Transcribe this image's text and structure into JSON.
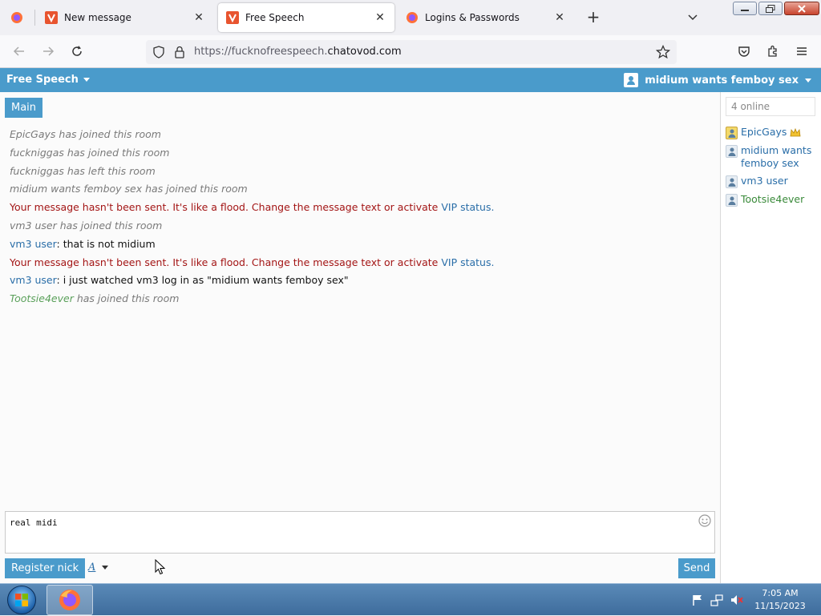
{
  "browser": {
    "tabs": [
      {
        "title": "New message",
        "active": false
      },
      {
        "title": "Free Speech",
        "active": true
      },
      {
        "title": "Logins & Passwords",
        "active": false
      }
    ],
    "url": {
      "prefix": "https://fucknofreespeech.",
      "domain": "chatovod.com"
    }
  },
  "header": {
    "room_title": "Free Speech",
    "user_name": "midium wants femboy sex"
  },
  "chat": {
    "room_tab": "Main",
    "messages": [
      {
        "kind": "sys",
        "text": "EpicGays has joined this room"
      },
      {
        "kind": "sys",
        "text": "fuckniggas has joined this room"
      },
      {
        "kind": "sys",
        "text": "fuckniggas has left this room"
      },
      {
        "kind": "sys",
        "text": "midium wants femboy sex has joined this room"
      },
      {
        "kind": "err",
        "text": "Your message hasn't been sent. It's like a flood. Change the message text or activate ",
        "link": "VIP status",
        "tail": "."
      },
      {
        "kind": "sys",
        "text": "vm3 user has joined this room"
      },
      {
        "kind": "text",
        "nick": "vm3 user",
        "text": ": that is not midium"
      },
      {
        "kind": "err",
        "text": "Your message hasn't been sent. It's like a flood. Change the message text or activate ",
        "link": "VIP status",
        "tail": "."
      },
      {
        "kind": "text",
        "nick": "vm3 user",
        "text": ": i just watched vm3 log in as \"midium wants femboy sex\""
      },
      {
        "kind": "sys",
        "nick_green": "Tootsie4ever",
        "text": " has joined this room"
      }
    ],
    "input_value": "real midi",
    "register_label": "Register nick",
    "font_label": "A",
    "send_label": "Send"
  },
  "sidebar": {
    "online_count": "4 online",
    "users": [
      {
        "name": "EpicGays",
        "color": "blue",
        "gold": true,
        "crown": true
      },
      {
        "name": "midium wants femboy sex",
        "color": "blue",
        "gold": false,
        "crown": false
      },
      {
        "name": "vm3 user",
        "color": "blue",
        "gold": false,
        "crown": false
      },
      {
        "name": "Tootsie4ever",
        "color": "green",
        "gold": false,
        "crown": false
      }
    ]
  },
  "taskbar": {
    "time": "7:05 AM",
    "date": "11/15/2023"
  },
  "colors": {
    "accent": "#4a9bcb",
    "error": "#a31515",
    "link": "#2a6ea8",
    "green_nick": "#5aa05a"
  }
}
